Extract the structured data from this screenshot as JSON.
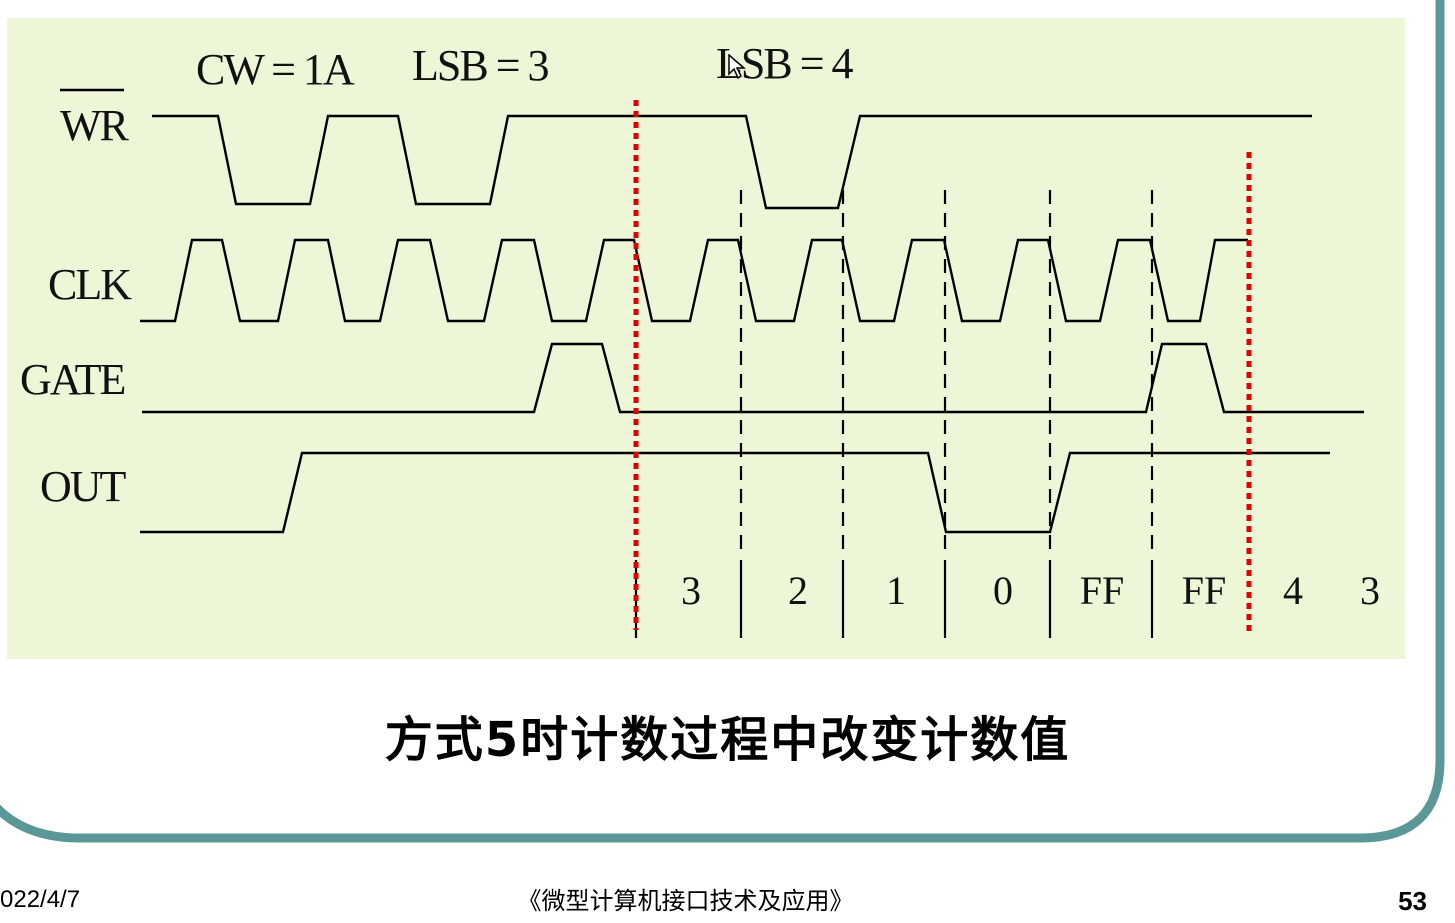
{
  "diagram": {
    "background_color": "#eef6d8",
    "frame_color": "#5a9898",
    "marker_color": "#e00000",
    "write_labels": {
      "cw": "CW = 1A",
      "lsb1": "LSB = 3",
      "lsb2": "LSB = 4"
    },
    "signals": {
      "wr": "WR",
      "clk": "CLK",
      "gate": "GATE",
      "out": "OUT"
    },
    "count_values": [
      "3",
      "2",
      "1",
      "0",
      "FF",
      "FF",
      "4",
      "3"
    ]
  },
  "caption": "方式5时计数过程中改变计数值",
  "footer": {
    "date": "022/4/7",
    "title": "《微型计算机接口技术及应用》",
    "page": "53"
  }
}
